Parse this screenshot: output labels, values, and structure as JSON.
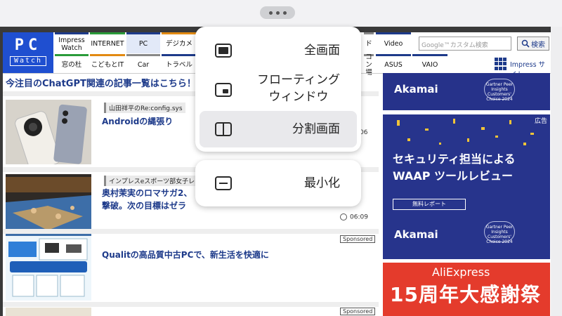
{
  "header": {
    "logo_top": "PC",
    "logo_bottom": "Watch",
    "nav_row1": [
      "Impress Watch",
      "INTERNET",
      "PC",
      "デジカメ",
      "ド",
      "Video"
    ],
    "nav_row2": [
      "窓の杜",
      "こどもとIT",
      "Car",
      "トラベル",
      "コン 場",
      "ASUS",
      "VAIO"
    ],
    "search_placeholder": "Google™カスタム検索",
    "search_button": "検索",
    "impress_site": "Impress サイト"
  },
  "headline": "今注目のChatGPT関連の記事一覧はこちら！",
  "articles": [
    {
      "tag": "山田祥平のRe:config.sys",
      "title": "Androidの縄張り",
      "time": "06"
    },
    {
      "tag": "インプレスeスポーツ部女子レト",
      "title": "奥村茉実のロマサガ2、\n撃破。次の目標はゼラ",
      "time": "06:09"
    },
    {
      "sponsored": "Sponsored",
      "title": "Qualitの高品質中古PCで、新生活を快適に"
    },
    {
      "sponsored": "Sponsored"
    }
  ],
  "ads": {
    "ad_badge": "広告",
    "akamai": "Akamai",
    "laurel": "Gartner Peer Insights Customers' Choice 2024",
    "main_line1": "セキュリティ担当による",
    "main_line2": "WAAP ツールレビュー",
    "button": "無料レポート",
    "ali_small": "AliExpress",
    "ali_big": "15周年大感謝祭"
  },
  "menu": {
    "items": [
      "全画面",
      "フローティング\nウィンドウ",
      "分割画面"
    ],
    "minimize": "最小化",
    "selected": "分割画面"
  }
}
